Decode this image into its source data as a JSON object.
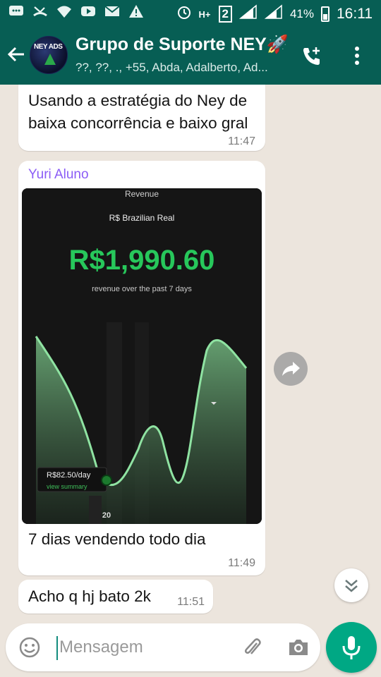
{
  "status_bar": {
    "battery_pct": "41%",
    "time": "16:11",
    "network": "H+",
    "sim": "2",
    "left_icons": [
      "whatsapp-notif-icon",
      "missed-call-icon",
      "wifi-icon",
      "youtube-icon",
      "mail-icon",
      "warning-icon"
    ],
    "right_icons": [
      "alarm-icon",
      "network-icon",
      "sim-icon",
      "signal-icon",
      "signal-icon",
      "battery-icon"
    ]
  },
  "header": {
    "title": "Grupo de Suporte NEY🚀",
    "subtitle": "??, ??, ., +55, Abda, Adalberto, Ad...",
    "avatar_text": "NEY ADS"
  },
  "messages": [
    {
      "text": "Usando a estratégia do Ney de baixa concorrência e baixo gral",
      "time": "11:47"
    },
    {
      "sender": "Yuri Aluno",
      "text": "7 dias vendendo todo dia",
      "time": "11:49",
      "image": {
        "title": "Revenue",
        "currency": "R$ Brazilian Real",
        "amount": "R$1,990.60",
        "caption": "revenue over the past 7 days",
        "tooltip_value": "R$82.50/day",
        "tooltip_link": "view summary",
        "x_label": "20"
      }
    },
    {
      "text": "Acho q hj bato 2k",
      "time": "11:51"
    }
  ],
  "input": {
    "placeholder": "Mensagem"
  },
  "colors": {
    "header": "#075e54",
    "accent": "#00a884",
    "sender_name": "#8b5cf6",
    "revenue_green": "#2ecc71"
  }
}
